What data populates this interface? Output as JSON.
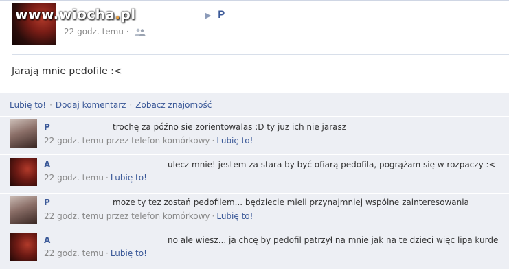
{
  "watermark": {
    "text": "www.wiocha.pl",
    "accent": "#f2a23a"
  },
  "post": {
    "author": "P",
    "time": "22 godz. temu",
    "separator": "·",
    "status": "Jarają mnie pedofile :<",
    "actions": {
      "like": "Lubię to!",
      "comment": "Dodaj komentarz",
      "friendship": "Zobacz znajomość"
    }
  },
  "comments": [
    {
      "author": "P",
      "text": "trochę za późno sie zorientowalas :D ty juz ich nie jarasz",
      "meta": "22 godz. temu przez telefon komórkowy",
      "like": "Lubię to!"
    },
    {
      "author": "A",
      "text": "ulecz mnie! jestem za stara by być ofiarą pedofila, pogrążam się w rozpaczy :<",
      "meta": "22 godz. temu",
      "like": "Lubię to!"
    },
    {
      "author": "P",
      "text": "moze ty tez zostań pedofilem... będziecie mieli przynajmniej wspólne zainteresowania",
      "meta": "22 godz. temu przez telefon komórkowy",
      "like": "Lubię to!"
    },
    {
      "author": "A",
      "text": "no ale wiesz... ja chcę by pedofil patrzył na mnie jak na te dzieci więc lipa kurde",
      "meta": "22 godz. temu",
      "like": "Lubię to!"
    }
  ],
  "colors": {
    "link": "#3b5998",
    "bar": "#edeff4",
    "meta": "#888888"
  },
  "icons": {
    "privacy": "people-icon",
    "arrow": "triangle-right-icon"
  }
}
